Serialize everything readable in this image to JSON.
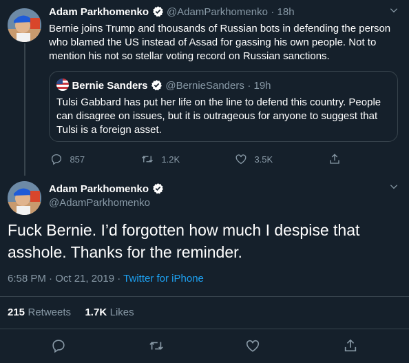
{
  "tweet1": {
    "name": "Adam Parkhomenko",
    "handle": "@AdamParkhomenko",
    "time": "· 18h",
    "text": "Bernie joins Trump and thousands of Russian bots in defending the person who blamed the US instead of Assad for gassing his own people. Not to mention his not so stellar voting record on Russian sanctions.",
    "quote": {
      "name": "Bernie Sanders",
      "handle": "@BernieSanders",
      "time": "· 19h",
      "text": "Tulsi Gabbard has put her life on the line to defend this country. People can disagree on issues, but it is outrageous for anyone to suggest that Tulsi is a foreign asset."
    },
    "actions": {
      "replies": "857",
      "retweets": "1.2K",
      "likes": "3.5K"
    }
  },
  "tweet2": {
    "name": "Adam Parkhomenko",
    "handle": "@AdamParkhomenko",
    "text": "Fuck Bernie. I’d forgotten how much I despise that asshole. Thanks for the reminder.",
    "timestamp": "6:58 PM · Oct 21, 2019 · ",
    "source": "Twitter for iPhone",
    "retweet_count": "215",
    "retweet_label": "Retweets",
    "like_count": "1.7K",
    "like_label": "Likes"
  },
  "colors": {
    "background": "#15202b",
    "accent": "#1da1f2",
    "muted": "#8899a6",
    "border": "#38444d"
  },
  "icons": [
    "verified-badge-icon",
    "chevron-down-icon",
    "reply-icon",
    "retweet-icon",
    "like-icon",
    "share-icon"
  ]
}
